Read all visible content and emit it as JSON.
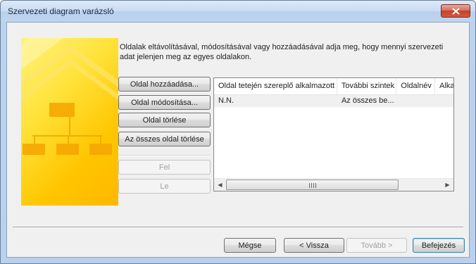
{
  "window": {
    "title": "Szervezeti diagram varázsló"
  },
  "instruction": "Oldalak eltávolításával, módosításával vagy hozzáadásával adja meg, hogy mennyi szervezeti adat jelenjen meg az egyes oldalakon.",
  "actions": {
    "add_page": "Oldal hozzáadása...",
    "modify_page": "Oldal módosítása...",
    "delete_page": "Oldal törlése",
    "delete_all": "Az összes oldal törlése",
    "move_up": "Fel",
    "move_down": "Le"
  },
  "list": {
    "columns": [
      "Oldal tetején szereplő alkalmazott",
      "További szintek",
      "Oldalnév",
      "Alka"
    ],
    "rows": [
      {
        "employee": "N.N.",
        "levels": "Az összes be...",
        "page_name": "",
        "extra": ""
      }
    ]
  },
  "footer": {
    "cancel": "Mégse",
    "back": "< Vissza",
    "next": "Tovább >",
    "finish": "Befejezés"
  },
  "colors": {
    "banner_yellow": "#ffd21e",
    "close_red": "#c2422c"
  }
}
